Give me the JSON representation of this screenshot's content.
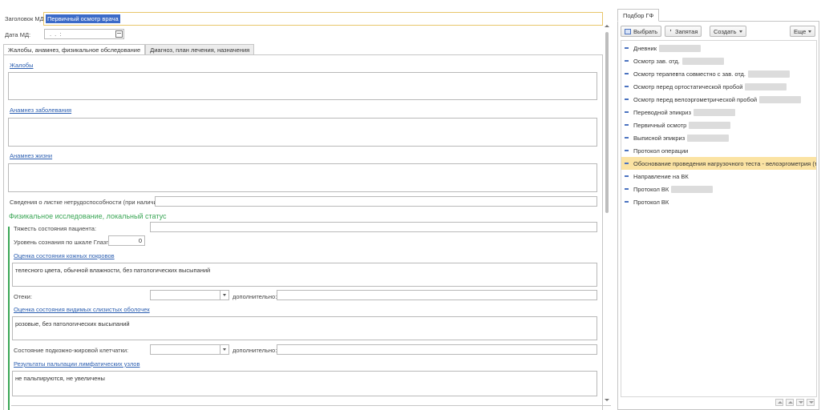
{
  "form": {
    "title_label": "Заголовок МД:",
    "title_value": "Первичный осмотр врача",
    "date_label": "Дата МД:",
    "date_mask": ". .   :",
    "tabs": [
      {
        "label": "Жалобы, анамнез, физикальное обследование"
      },
      {
        "label": "Диагноз, план лечения, назначения"
      }
    ],
    "complaints_link": "Жалобы",
    "anamnesis_disease_link": "Анамнез заболевания",
    "anamnesis_life_link": "Анамнез жизни",
    "sick_leave_label": "Сведения о листке нетрудоспособности (при наличии):",
    "physical_section_title": "Физикальное исследование, локальный статус",
    "severity_label": "Тяжесть состояния пациента:",
    "glasgow_label": "Уровень сознания по шкале Глазго:",
    "glasgow_value": "0",
    "skin_link": "Оценка состояния кожных покровов",
    "skin_text": "телесного цвета, обычной влажности, без патологических высыпаний",
    "edema_label": "Отеки:",
    "additional_label": "дополнительно:",
    "mucosa_link": "Оценка состояния видимых слизистых оболочек",
    "mucosa_text": "розовые, без патологических высыпаний",
    "fat_label": "Состояние подкожно-жировой клетчатки:",
    "additional_label_2": "дополнительно:",
    "lymph_link": "Результаты пальпации лимфатических узлов",
    "lymph_text": "не пальпируются, не увеличены"
  },
  "right_panel": {
    "tab_label": "Подбор ГФ",
    "select_button": "Выбрать",
    "comma_button": "Запятая",
    "create_button": "Создать",
    "more_button": "Еще",
    "items": [
      {
        "label": "Дневник"
      },
      {
        "label": "Осмотр зав. отд."
      },
      {
        "label": "Осмотр терапевта совместно с зав. отд."
      },
      {
        "label": "Осмотр перед ортостатической пробой"
      },
      {
        "label": "Осмотр перед велоэргометрической пробой"
      },
      {
        "label": "Переводной эпикриз"
      },
      {
        "label": "Первичный осмотр"
      },
      {
        "label": "Выписной эпикриз"
      },
      {
        "label": "Протокол операции"
      },
      {
        "label": "Обоснование проведения нагрузочного теста - велоэргометрия (т..."
      },
      {
        "label": "Направление на ВК"
      },
      {
        "label": "Протокол ВК"
      },
      {
        "label": "Протокол ВК"
      }
    ]
  }
}
